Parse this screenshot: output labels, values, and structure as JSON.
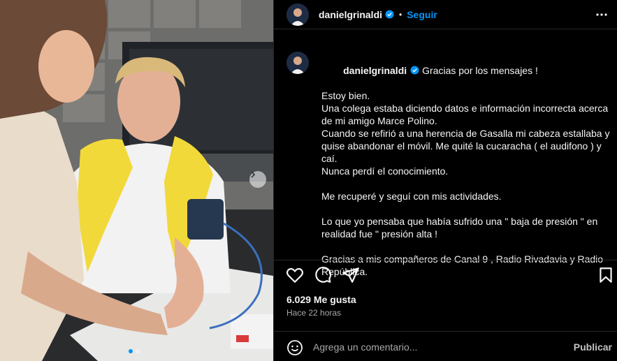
{
  "post": {
    "username": "danielgrinaldi",
    "separator": "•",
    "follow_label": "Seguir",
    "verified": true
  },
  "caption": {
    "username": "danielgrinaldi",
    "first_line": "Gracias por los mensajes !",
    "block1": "Estoy bien.\nUna colega estaba diciendo datos e información incorrecta acerca de mi amigo Marce Polino.\nCuando se refirió a una herencia de Gasalla mi cabeza estallaba y quise abandonar el móvil. Me quité la cucaracha ( el audifono ) y caí.\nNunca perdí el conocimiento.",
    "block2": "Me recuperé y seguí con mis actividades.",
    "block3": "Lo que yo pensaba que había sufrido una \" baja de presión \" en realidad fue \" presión alta !",
    "block4": "Gracias a mis compañeros de Canal 9 , Radio Rivadavia y Radio República."
  },
  "stats": {
    "likes": "6.029 Me gusta",
    "time": "Hace 22 horas"
  },
  "comment": {
    "placeholder": "Agrega un comentario...",
    "publish_label": "Publicar"
  },
  "carousel": {
    "slide_count": 2,
    "active_index": 0
  },
  "icons": {
    "like": "heart-icon",
    "comment": "comment-icon",
    "share": "share-icon",
    "save": "bookmark-icon",
    "more": "more-options-icon",
    "emoji": "emoji-icon",
    "next": "chevron-right-icon",
    "verified": "verified-badge-icon"
  },
  "colors": {
    "accent": "#0095f6",
    "background": "#000000",
    "text": "#f5f5f5",
    "muted": "#a8a8a8"
  }
}
